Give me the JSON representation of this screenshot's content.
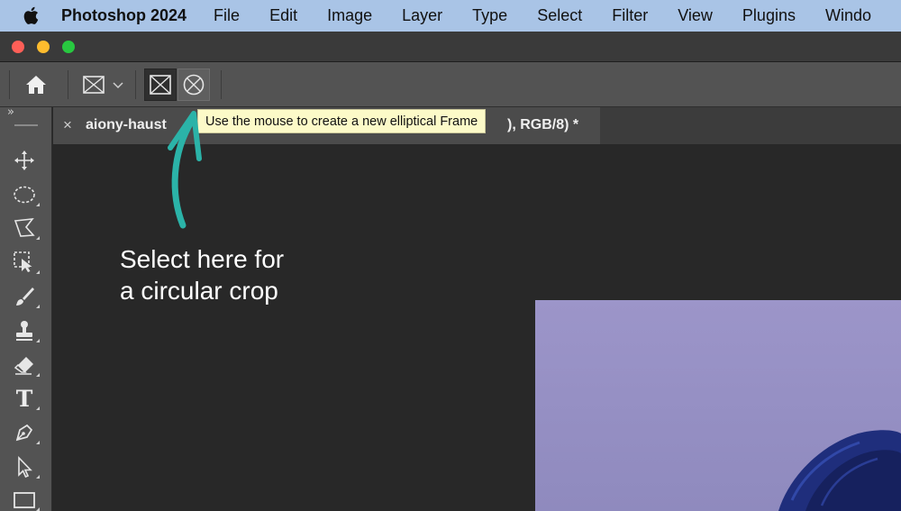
{
  "menubar": {
    "app_name": "Photoshop 2024",
    "items": [
      "File",
      "Edit",
      "Image",
      "Layer",
      "Type",
      "Select",
      "Filter",
      "View",
      "Plugins",
      "Windo"
    ]
  },
  "window": {
    "traffic_lights": {
      "close": "#fe5f57",
      "minimize": "#febc2e",
      "zoom": "#28c840"
    }
  },
  "options_bar": {
    "tools": [
      "home-icon",
      "frame-tool-preset-icon",
      "chevron-down-icon",
      "rectangular-frame-icon",
      "elliptical-frame-icon"
    ],
    "selected": "elliptical-frame"
  },
  "panel_collapse_glyph": "»",
  "document_tab": {
    "close_glyph": "×",
    "name": "aiony-haust",
    "name_suffix": "), RGB/8) *"
  },
  "tooltip": {
    "text": "Use the mouse to create a new elliptical Frame"
  },
  "annotation": {
    "line1": "Select here for",
    "line2": "a circular crop",
    "arrow_color": "#2bb3a8"
  },
  "tool_panel": {
    "tools": [
      "move-icon",
      "elliptical-marquee-icon",
      "polygonal-lasso-icon",
      "object-selection-icon",
      "brush-icon",
      "clone-stamp-icon",
      "eraser-icon",
      "type-icon",
      "pen-icon",
      "path-selection-icon",
      "rectangle-icon"
    ],
    "type_glyph": "T"
  }
}
